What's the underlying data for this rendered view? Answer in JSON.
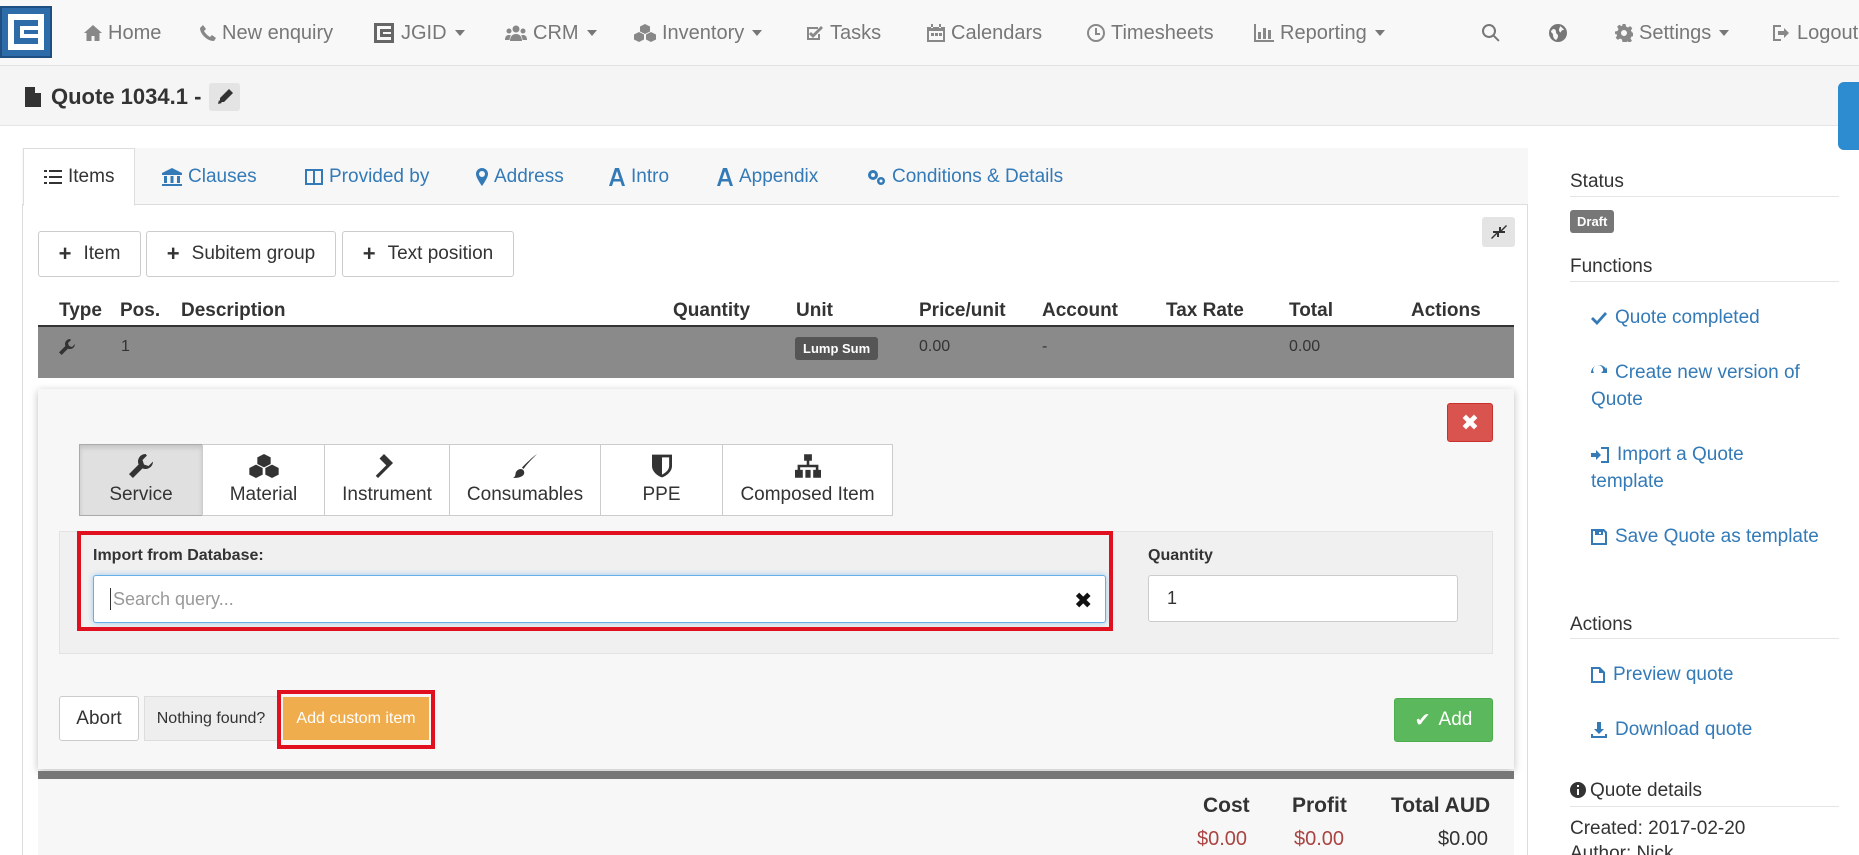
{
  "nav": {
    "home": "Home",
    "new_enquiry": "New enquiry",
    "jgid": "JGID",
    "crm": "CRM",
    "inventory": "Inventory",
    "tasks": "Tasks",
    "calendars": "Calendars",
    "timesheets": "Timesheets",
    "reporting": "Reporting",
    "settings": "Settings",
    "logout": "Logout"
  },
  "page": {
    "title": "Quote 1034.1 -"
  },
  "tabs": [
    {
      "label": "Items",
      "icon": "list-icon"
    },
    {
      "label": "Clauses",
      "icon": "bank-icon"
    },
    {
      "label": "Provided by",
      "icon": "window-icon"
    },
    {
      "label": "Address",
      "icon": "map-marker-icon"
    },
    {
      "label": "Intro",
      "icon": "font-icon"
    },
    {
      "label": "Appendix",
      "icon": "font-icon"
    },
    {
      "label": "Conditions & Details",
      "icon": "gears-icon"
    }
  ],
  "toolbar": {
    "item": "Item",
    "subitem_group": "Subitem group",
    "text_position": "Text position"
  },
  "table": {
    "headers": [
      "Type",
      "Pos.",
      "Description",
      "Quantity",
      "Unit",
      "Price/unit",
      "Account",
      "Tax Rate",
      "Total",
      "Actions"
    ],
    "row": {
      "pos": "1",
      "unit": "Lump Sum",
      "price": "0.00",
      "account": "-",
      "total": "0.00"
    }
  },
  "editor": {
    "types": [
      "Service",
      "Material",
      "Instrument",
      "Consumables",
      "PPE",
      "Composed Item"
    ],
    "import_label": "Import from Database:",
    "search_placeholder": "Search query...",
    "quantity_label": "Quantity",
    "quantity_value": "1",
    "abort": "Abort",
    "nothing_found": "Nothing found?",
    "add_custom": "Add custom item",
    "add": "Add"
  },
  "totals": {
    "cost_label": "Cost",
    "profit_label": "Profit",
    "total_label": "Total AUD",
    "cost": "$0.00",
    "profit": "$0.00",
    "total": "$0.00"
  },
  "sidebar": {
    "status_label": "Status",
    "status_badge": "Draft",
    "functions_label": "Functions",
    "quote_completed": "Quote completed",
    "new_version": "Create new version of Quote",
    "import_template": "Import a Quote template",
    "save_template": "Save Quote as template",
    "actions_label": "Actions",
    "preview": "Preview quote",
    "download": "Download quote",
    "details_label": "Quote details",
    "created": "Created: 2017-02-20",
    "author": "Author: Nick"
  },
  "colors": {
    "primary": "#337ab7",
    "danger": "#d9534f",
    "warning": "#f0ad4e",
    "success": "#5cb85c",
    "highlight": "#e0101f"
  }
}
